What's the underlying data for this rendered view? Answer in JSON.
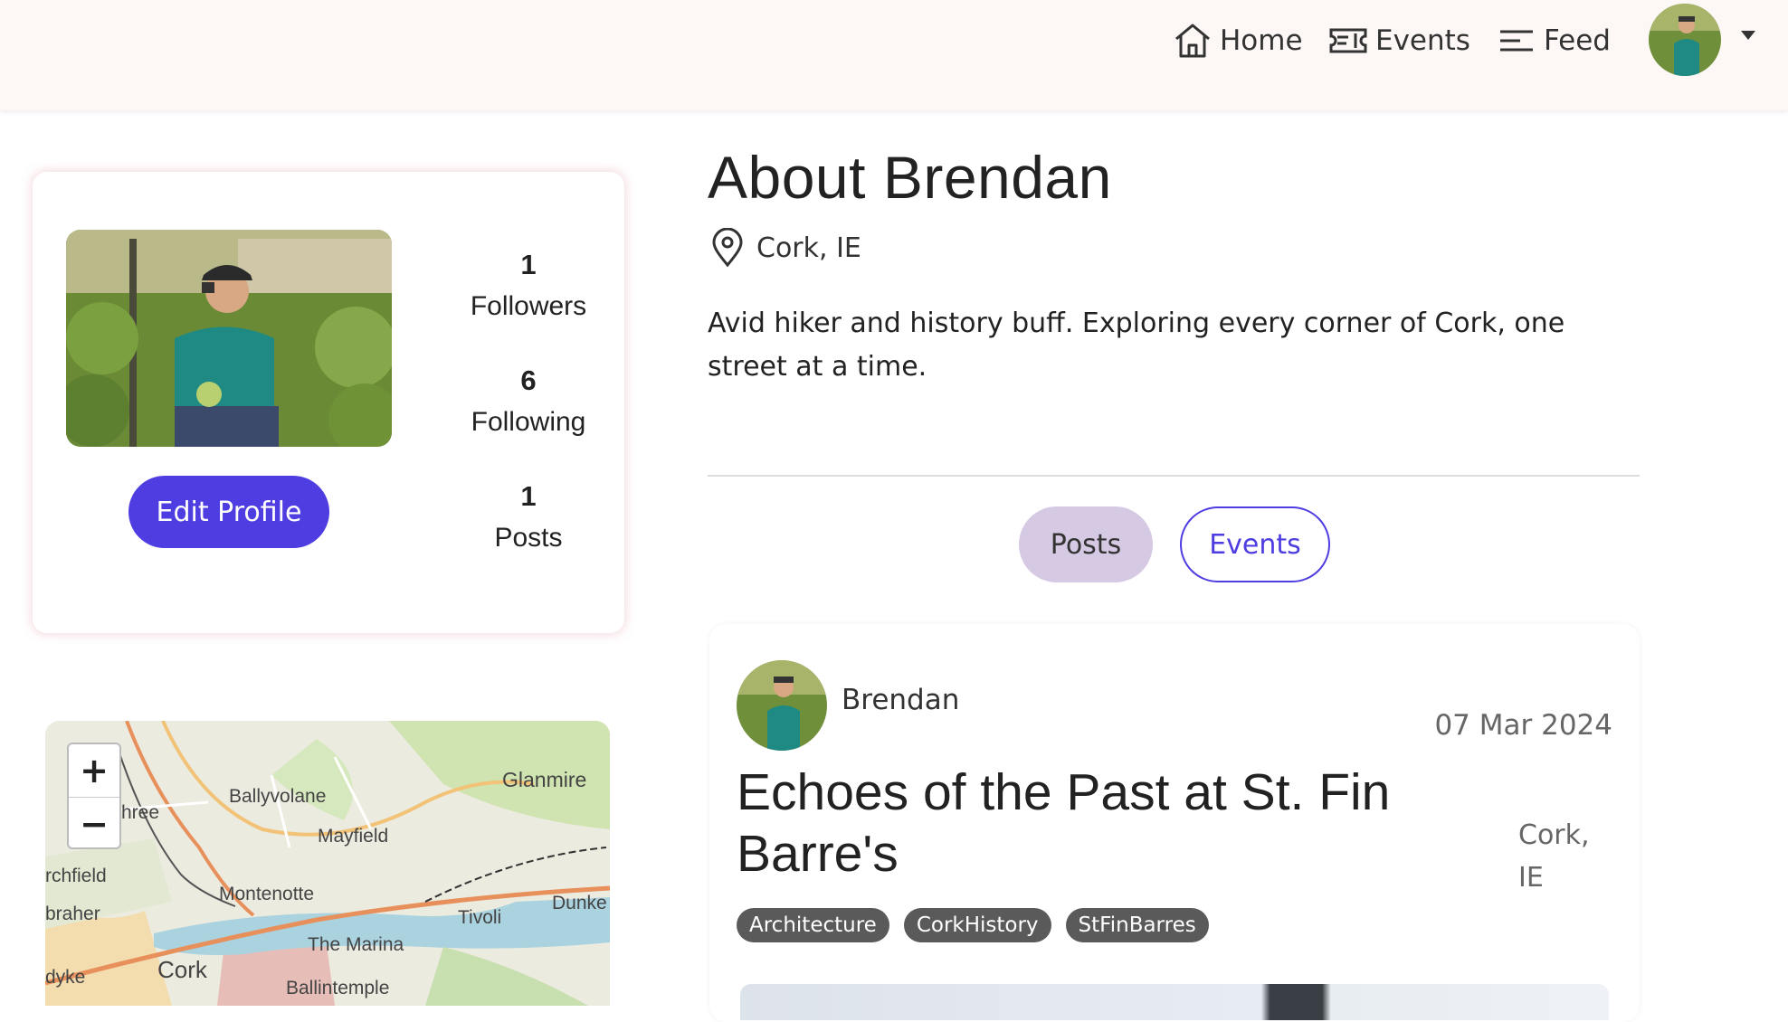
{
  "nav": {
    "home_label": "Home",
    "events_label": "Events",
    "feed_label": "Feed",
    "home_icon": "home-icon",
    "events_icon": "ticket-icon",
    "feed_icon": "menu-lines-icon"
  },
  "profile": {
    "followers_count": "1",
    "followers_label": "Followers",
    "following_count": "6",
    "following_label": "Following",
    "posts_count": "1",
    "posts_label": "Posts",
    "edit_label": "Edit Profile"
  },
  "map": {
    "zoom_in": "+",
    "zoom_out": "−",
    "labels": {
      "glanmire": "Glanmire",
      "ballyvolane": "Ballyvolane",
      "mayfield": "Mayfield",
      "montenotte": "Montenotte",
      "tivoli": "Tivoli",
      "dunkettle": "Dunke",
      "the_marina": "The Marina",
      "ballintemple": "Ballintemple",
      "cork": "Cork",
      "churchfield": "rchfield",
      "fairhill": "hree",
      "gurranabraher": "braher",
      "dyke": "dyke"
    }
  },
  "about": {
    "title": "About Brendan",
    "location": "Cork, IE",
    "bio": "Avid hiker and history buff. Exploring every corner of Cork, one street at a time."
  },
  "tabs": {
    "posts": "Posts",
    "events": "Events"
  },
  "post": {
    "author": "Brendan",
    "date": "07 Mar 2024",
    "title": "Echoes of the Past at St. Fin Barre's",
    "location": "Cork, IE",
    "tags": [
      "Architecture",
      "CorkHistory",
      "StFinBarres"
    ]
  },
  "colors": {
    "accent": "#4e3de0",
    "tab_active_bg": "#d6c9e3",
    "tag_bg": "#5a5a5a",
    "navbar_bg": "#fdf8f6"
  }
}
